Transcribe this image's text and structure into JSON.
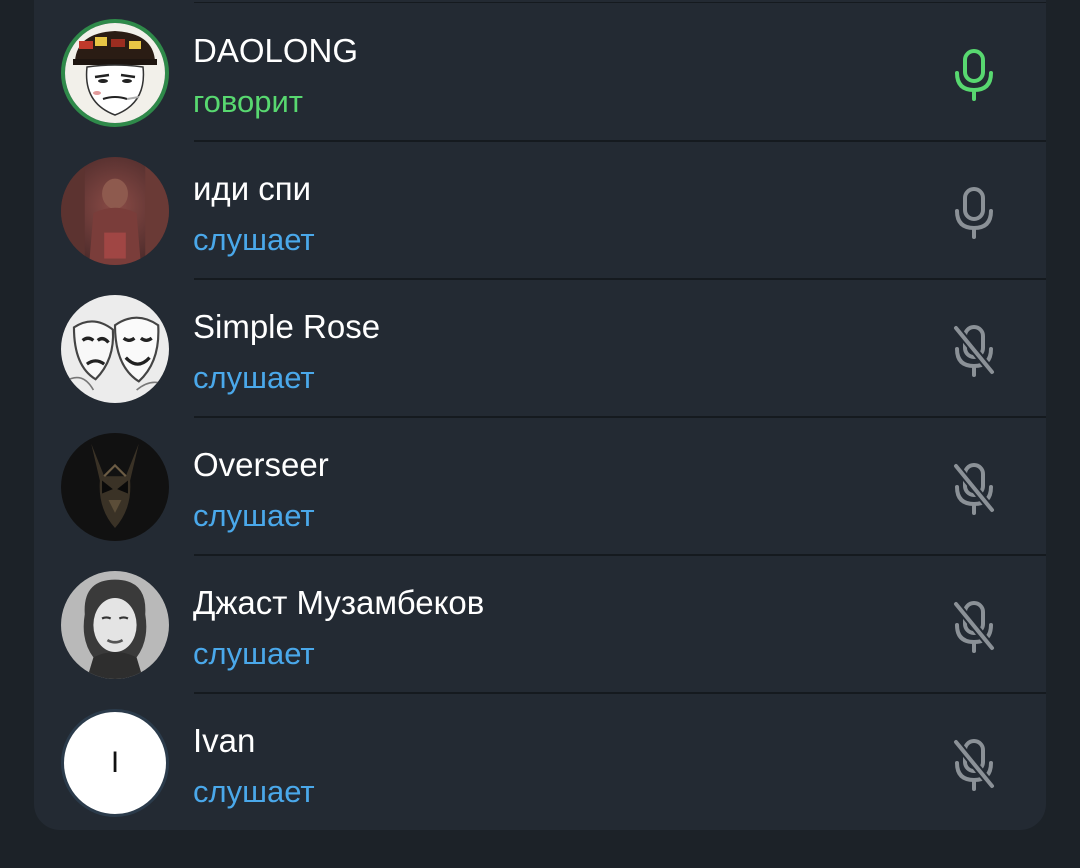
{
  "participants": [
    {
      "name": "DAOLONG",
      "status": "говорит",
      "state": "speaking",
      "mic": "mic-on-icon",
      "avatar": "cartoon-face-avatar"
    },
    {
      "name": "иди спи",
      "status": "слушает",
      "state": "listening",
      "mic": "mic-icon",
      "avatar": "photo-avatar"
    },
    {
      "name": "Simple Rose",
      "status": "слушает",
      "state": "listening",
      "mic": "mic-muted-icon",
      "avatar": "theater-masks-avatar"
    },
    {
      "name": "Overseer",
      "status": "слушает",
      "state": "listening",
      "mic": "mic-muted-icon",
      "avatar": "dark-mask-avatar"
    },
    {
      "name": "Джаст Музамбеков",
      "status": "слушает",
      "state": "listening",
      "mic": "mic-muted-icon",
      "avatar": "portrait-avatar"
    },
    {
      "name": "Ivan",
      "status": "слушает",
      "state": "listening",
      "mic": "mic-muted-icon",
      "avatar": "letter-avatar",
      "initial": "I"
    }
  ],
  "colors": {
    "background": "#1c2228",
    "panel": "#232a33",
    "speaking": "#58d870",
    "listening": "#4aa8ea",
    "mic_idle": "#8b9197"
  }
}
